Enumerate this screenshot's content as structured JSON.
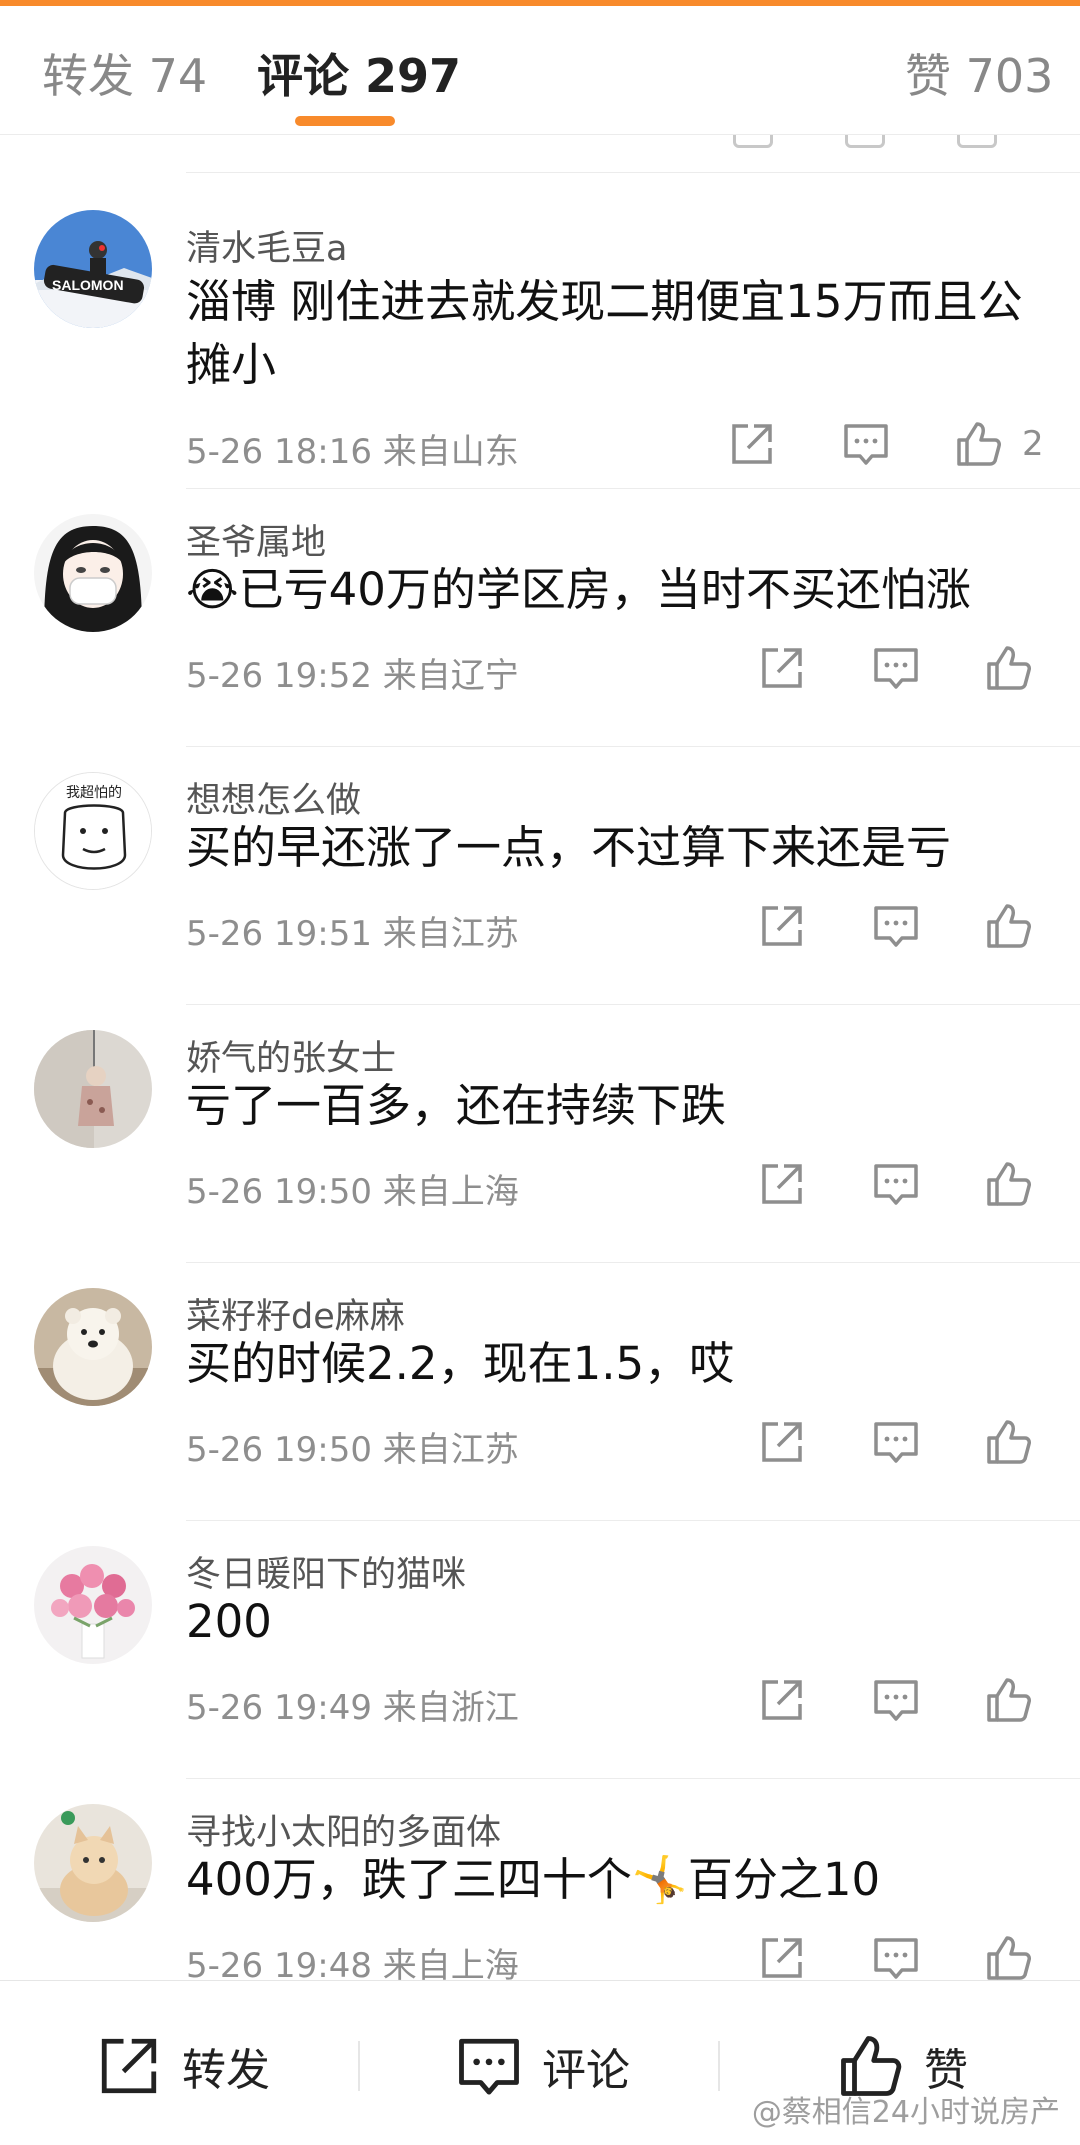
{
  "colors": {
    "accent": "#f88a2b",
    "meta_text": "#8e8e8e",
    "divider": "#ececec"
  },
  "tabs": {
    "repost": "转发 74",
    "comment": "评论 297",
    "like": "赞 703",
    "active": "comment"
  },
  "comments": [
    {
      "name": "清水毛豆a",
      "body": "淄博 刚住进去就发现二期便宜15万而且公摊小",
      "meta": "5-26 18:16 来自山东",
      "likes": "2",
      "avatar": "snowboarder-photo"
    },
    {
      "name": "圣爷属地",
      "body": "😭已亏40万的学区房，当时不买还怕涨",
      "meta": "5-26 19:52 来自辽宁",
      "likes": "",
      "avatar": "masked-anime-girl"
    },
    {
      "name": "想想怎么做",
      "body": "买的早还涨了一点，不过算下来还是亏",
      "meta": "5-26 19:51 来自江苏",
      "likes": "",
      "avatar": "doodle-face",
      "avatar_text": "我超怕的"
    },
    {
      "name": "娇气的张女士",
      "body": "亏了一百多，还在持续下跌",
      "meta": "5-26 19:50 来自上海",
      "likes": "",
      "avatar": "hanging-doll-photo"
    },
    {
      "name": "菜籽籽de麻麻",
      "body": "买的时候2.2，现在1.5，哎",
      "meta": "5-26 19:50 来自江苏",
      "likes": "",
      "avatar": "white-dog-photo"
    },
    {
      "name": "冬日暖阳下的猫咪",
      "body": "200",
      "meta": "5-26 19:49 来自浙江",
      "likes": "",
      "avatar": "pink-flowers-photo"
    },
    {
      "name": "寻找小太阳的多面体",
      "body": "400万，跌了三四十个🤸百分之10",
      "meta": "5-26 19:48 来自上海",
      "likes": "",
      "avatar": "cat-photo"
    }
  ],
  "bottom_bar": {
    "repost": "转发",
    "comment": "评论",
    "like": "赞"
  },
  "watermark": "@蔡相信24小时说房产",
  "icons": [
    "share-icon",
    "comment-icon",
    "thumbs-up-icon"
  ]
}
